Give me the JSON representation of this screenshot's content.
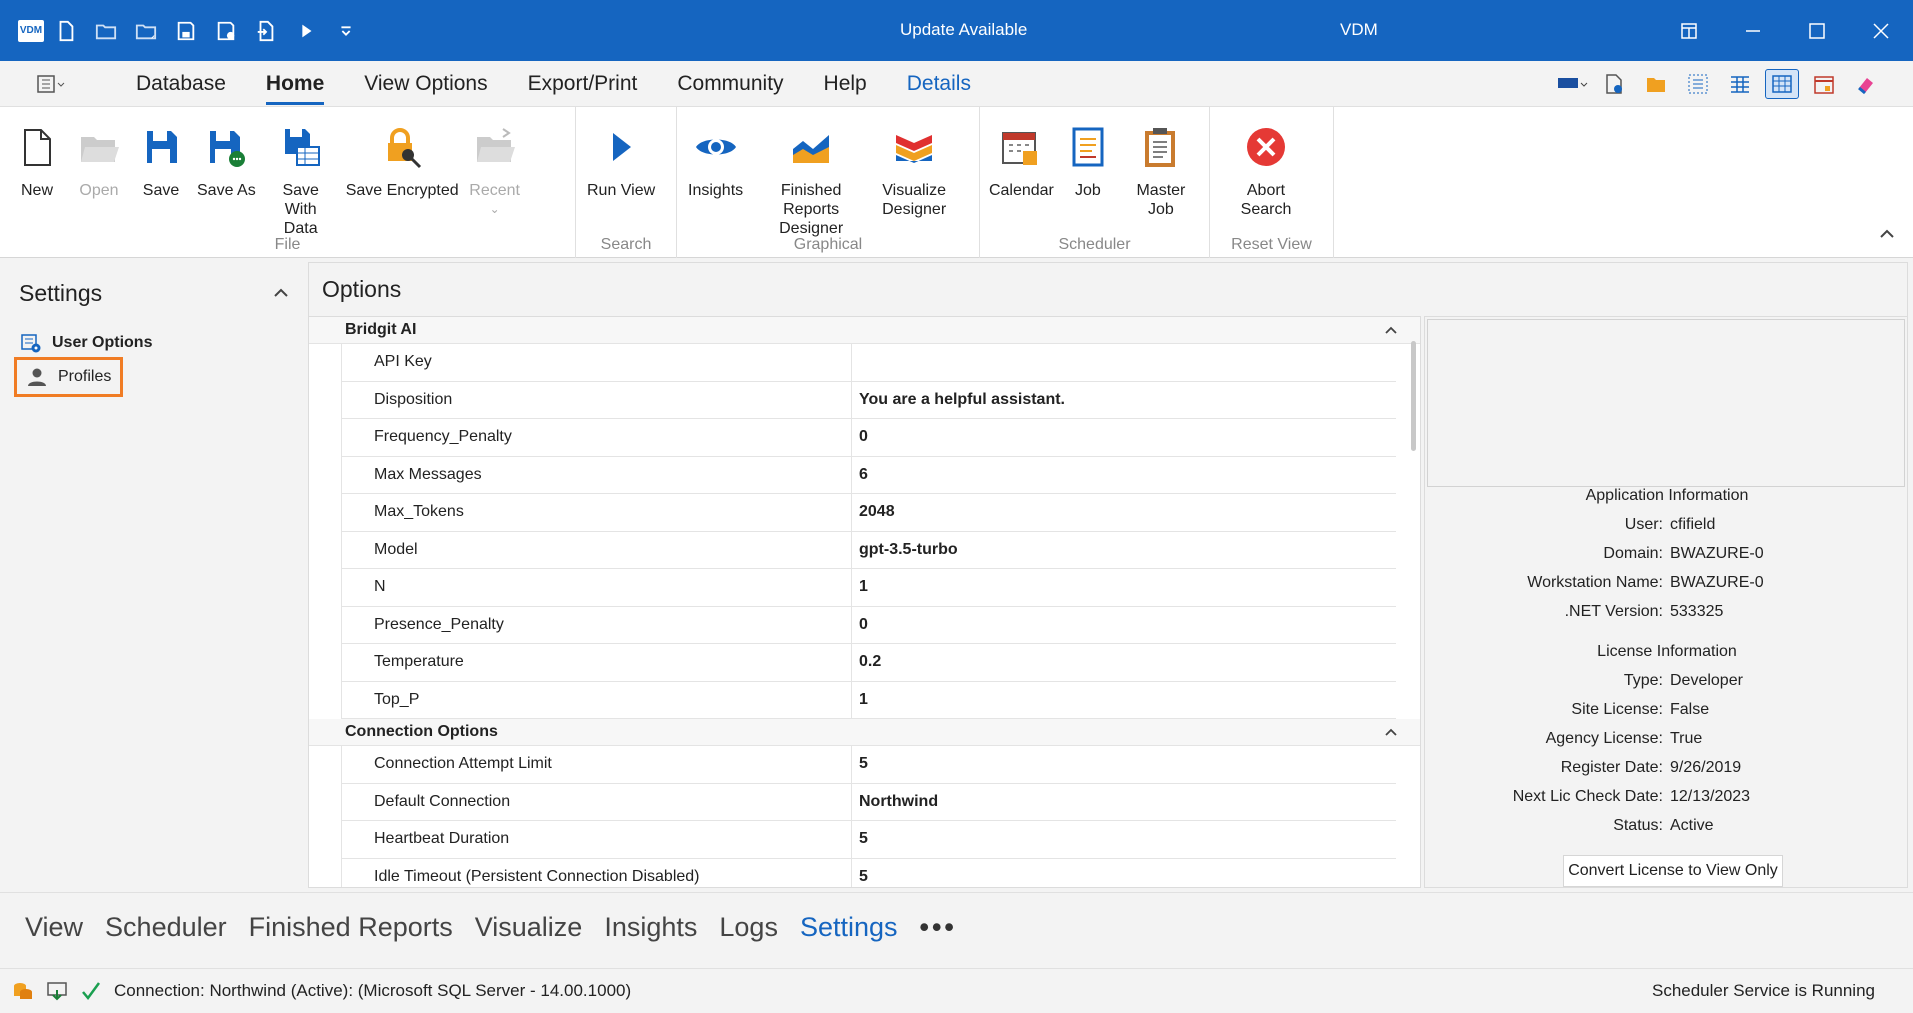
{
  "titlebar": {
    "logo": "VDM",
    "center_text": "Update Available",
    "app_name": "VDM",
    "icons": [
      "new-file-icon",
      "open-folder-icon",
      "open-recent-icon",
      "save-icon",
      "save-as-icon",
      "import-icon",
      "run-icon",
      "customize-qat-icon"
    ]
  },
  "ribbon_tabs": [
    "Database",
    "Home",
    "View Options",
    "Export/Print",
    "Community",
    "Help",
    "Details"
  ],
  "ribbon": {
    "file": {
      "label": "File",
      "buttons": {
        "new": "New",
        "open": "Open",
        "save": "Save",
        "save_as": "Save As",
        "save_with_data": "Save With Data",
        "save_encrypted": "Save Encrypted",
        "recent": "Recent"
      }
    },
    "search": {
      "label": "Search",
      "run_view": "Run View"
    },
    "graphical": {
      "label": "Graphical",
      "insights": "Insights",
      "finished_reports": "Finished Reports Designer",
      "visualize": "Visualize Designer"
    },
    "scheduler": {
      "label": "Scheduler",
      "calendar": "Calendar",
      "job": "Job",
      "master_job": "Master Job"
    },
    "reset_view": {
      "label": "Reset View",
      "abort_search": "Abort Search"
    }
  },
  "settings_panel": {
    "title": "Settings",
    "items": {
      "user_options": "User Options",
      "profiles": "Profiles"
    }
  },
  "options": {
    "title": "Options",
    "categories": [
      {
        "name": "Bridgit AI",
        "rows": [
          {
            "name": "API Key",
            "value": ""
          },
          {
            "name": "Disposition",
            "value": "You are a helpful assistant."
          },
          {
            "name": "Frequency_Penalty",
            "value": "0"
          },
          {
            "name": "Max Messages",
            "value": "6"
          },
          {
            "name": "Max_Tokens",
            "value": "2048"
          },
          {
            "name": "Model",
            "value": "gpt-3.5-turbo"
          },
          {
            "name": "N",
            "value": "1"
          },
          {
            "name": "Presence_Penalty",
            "value": "0"
          },
          {
            "name": "Temperature",
            "value": "0.2"
          },
          {
            "name": "Top_P",
            "value": "1"
          }
        ]
      },
      {
        "name": "Connection Options",
        "rows": [
          {
            "name": "Connection Attempt Limit",
            "value": "5"
          },
          {
            "name": "Default Connection",
            "value": "Northwind"
          },
          {
            "name": "Heartbeat Duration",
            "value": "5"
          },
          {
            "name": "Idle Timeout (Persistent Connection Disabled)",
            "value": "5"
          }
        ]
      }
    ]
  },
  "app_info": {
    "app_title": "Application Information",
    "user_k": "User:",
    "user_v": "cfifield",
    "domain_k": "Domain:",
    "domain_v": "BWAZURE-0",
    "ws_k": "Workstation Name:",
    "ws_v": "BWAZURE-0",
    "net_k": ".NET Version:",
    "net_v": "533325",
    "lic_title": "License Information",
    "type_k": "Type:",
    "type_v": "Developer",
    "site_k": "Site License:",
    "site_v": "False",
    "agency_k": "Agency License:",
    "agency_v": "True",
    "reg_k": "Register Date:",
    "reg_v": "9/26/2019",
    "next_k": "Next Lic Check Date:",
    "next_v": "12/13/2023",
    "status_k": "Status:",
    "status_v": "Active",
    "convert_btn": "Convert License to View Only"
  },
  "bottom_nav": [
    "View",
    "Scheduler",
    "Finished Reports",
    "Visualize",
    "Insights",
    "Logs",
    "Settings",
    "•••"
  ],
  "status": {
    "connection": "Connection: Northwind (Active): (Microsoft SQL Server - 14.00.1000)",
    "right": "Scheduler Service is Running"
  },
  "colors": {
    "accent": "#1565c0",
    "highlight": "#f07c24"
  }
}
